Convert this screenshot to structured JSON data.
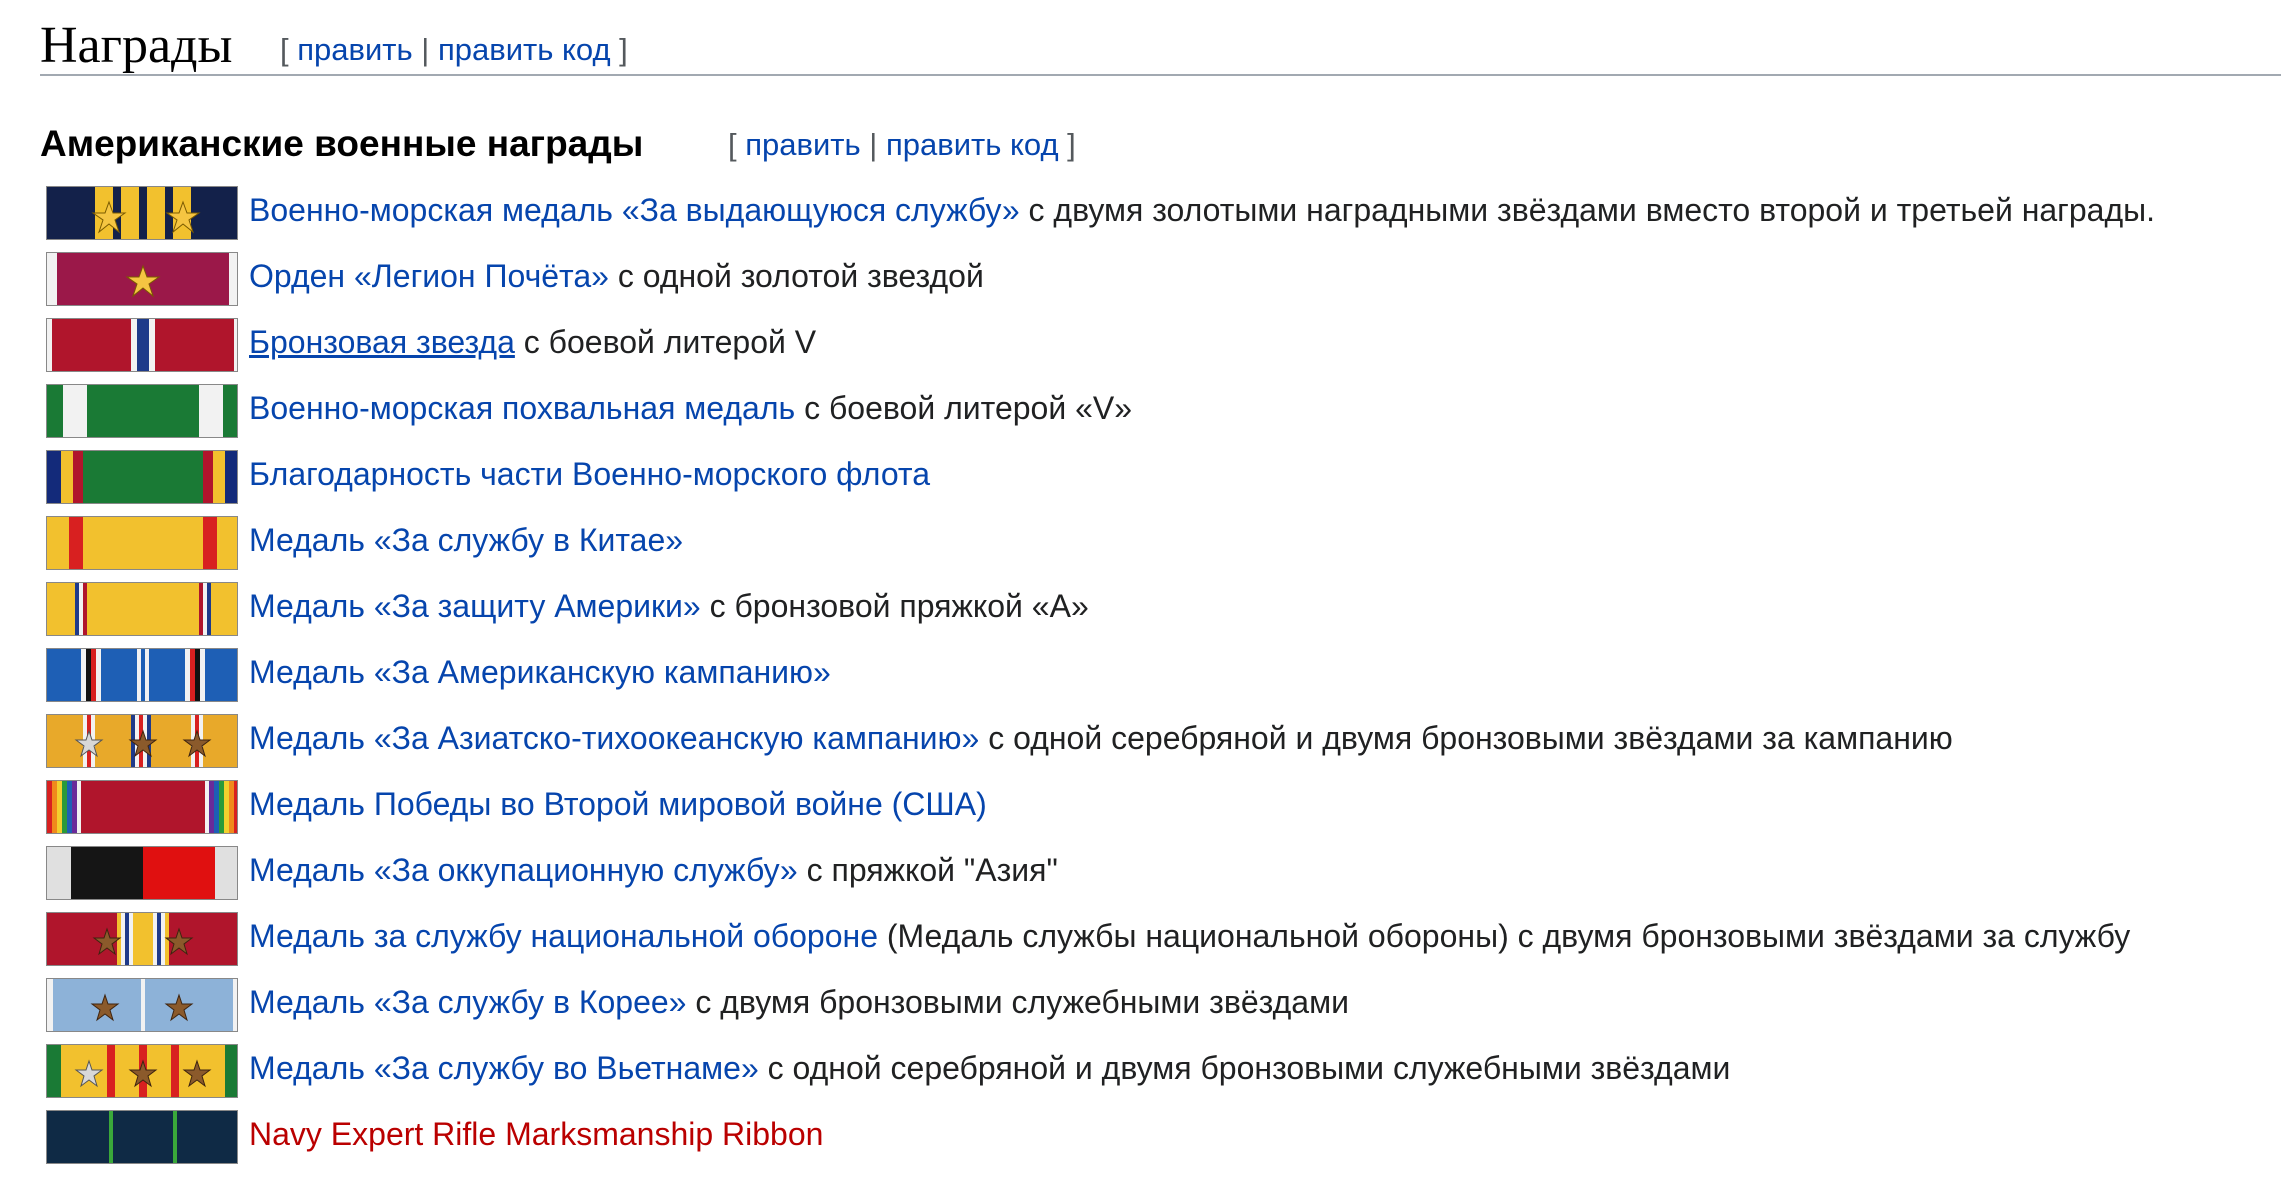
{
  "section": {
    "title": "Награды",
    "edit_open": "[",
    "edit_label": "править",
    "separator": "|",
    "edit_code_label": "править код",
    "edit_close": "]"
  },
  "subsection": {
    "title": "Американские военные награды",
    "edit_open": "[",
    "edit_label": "править",
    "separator": "|",
    "edit_code_label": "править код",
    "edit_close": "]"
  },
  "awards": [
    {
      "link": "Военно-морская медаль «За выдающуюся службу»",
      "desc": " с двумя золотыми наградными звёздами вместо второй и третьей награды.",
      "ribbon": "navy-distinguished-service-ribbon",
      "devices": [
        "gold-star",
        "gold-star"
      ]
    },
    {
      "link": "Орден «Легион Почёта»",
      "desc": " с одной золотой звездой",
      "ribbon": "legion-of-merit-ribbon",
      "devices": [
        "gold-star"
      ]
    },
    {
      "link": "Бронзовая звезда",
      "desc": " с боевой литерой V",
      "ribbon": "bronze-star-ribbon",
      "devices": []
    },
    {
      "link": "Военно-морская похвальная медаль",
      "desc": " с боевой литерой «V»",
      "ribbon": "navy-commendation-ribbon",
      "devices": []
    },
    {
      "link": "Благодарность части Военно-морского флота",
      "desc": "",
      "ribbon": "navy-unit-commendation-ribbon",
      "devices": []
    },
    {
      "link": "Медаль «За службу в Китае»",
      "desc": "",
      "ribbon": "china-service-ribbon",
      "devices": []
    },
    {
      "link": "Медаль «За защиту Америки»",
      "desc": " с бронзовой пряжкой «A»",
      "ribbon": "american-defense-ribbon",
      "devices": []
    },
    {
      "link": "Медаль «За Американскую кампанию»",
      "desc": "",
      "ribbon": "american-campaign-ribbon",
      "devices": []
    },
    {
      "link": "Медаль «За Азиатско-тихоокеанскую кампанию»",
      "desc": " с одной серебряной и двумя бронзовыми звёздами за кампанию",
      "ribbon": "asiatic-pacific-campaign-ribbon",
      "devices": [
        "silver-star",
        "bronze-star",
        "bronze-star"
      ]
    },
    {
      "link": "Медаль Победы во Второй мировой войне (США)",
      "desc": "",
      "ribbon": "ww2-victory-ribbon",
      "devices": []
    },
    {
      "link": "Медаль «За оккупационную службу»",
      "desc": " с пряжкой \"Азия\"",
      "ribbon": "occupation-service-ribbon",
      "devices": []
    },
    {
      "link": "Медаль за службу национальной обороне",
      "desc": " (Медаль службы национальной обороны) с двумя бронзовыми звёздами за службу",
      "ribbon": "national-defense-ribbon",
      "devices": [
        "bronze-star",
        "bronze-star"
      ]
    },
    {
      "link": "Медаль «За службу в Корее»",
      "desc": " с двумя бронзовыми служебными звёздами",
      "ribbon": "korean-service-ribbon",
      "devices": [
        "bronze-star",
        "bronze-star"
      ]
    },
    {
      "link": "Медаль «За службу во Вьетнаме»",
      "desc": " с одной серебряной и двумя бронзовыми служебными звёздами",
      "ribbon": "vietnam-service-ribbon",
      "devices": [
        "silver-star",
        "bronze-star",
        "bronze-star"
      ]
    },
    {
      "link": "Navy Expert Rifle Marksmanship Ribbon",
      "desc": "",
      "ribbon": "navy-expert-rifle-ribbon",
      "devices": []
    }
  ],
  "colors": {
    "link": "#0645ad",
    "redlink": "#ba0000",
    "text": "#202122",
    "bracket": "#54595d",
    "heading_rule": "#a2a9b1"
  }
}
